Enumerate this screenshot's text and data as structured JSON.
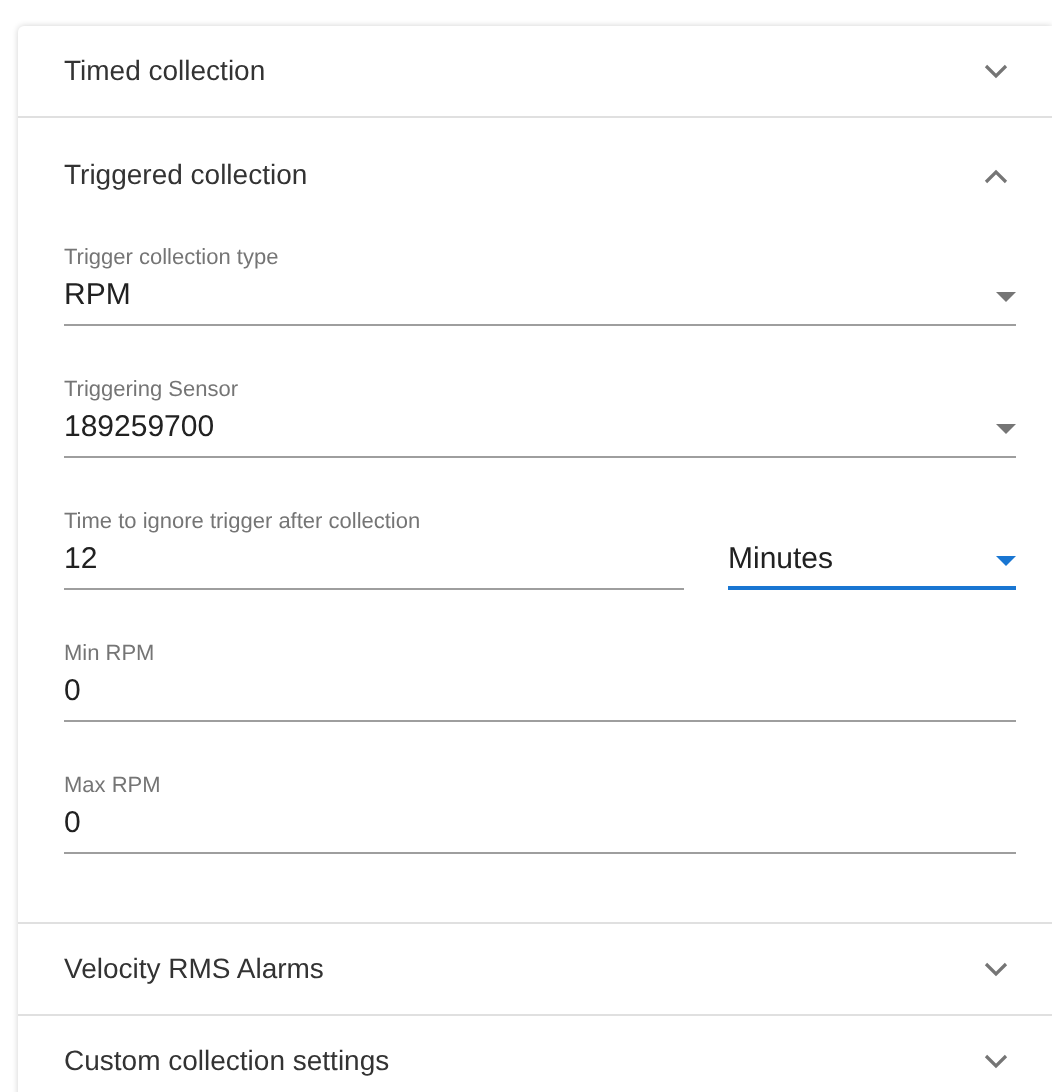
{
  "sections": [
    {
      "title": "Timed collection",
      "expanded": false
    },
    {
      "title": "Triggered collection",
      "expanded": true,
      "fields": [
        {
          "kind": "select",
          "label": "Trigger collection type",
          "value": "RPM"
        },
        {
          "kind": "select",
          "label": "Triggering Sensor",
          "value": "189259700"
        },
        {
          "kind": "number_with_unit",
          "label": "Time to ignore trigger after collection",
          "value": "12",
          "unit": {
            "value": "Minutes",
            "focused": true
          }
        },
        {
          "kind": "number",
          "label": "Min RPM",
          "value": "0"
        },
        {
          "kind": "number",
          "label": "Max RPM",
          "value": "0"
        }
      ]
    },
    {
      "title": "Velocity RMS Alarms",
      "expanded": false
    },
    {
      "title": "Custom collection settings",
      "expanded": false
    }
  ]
}
